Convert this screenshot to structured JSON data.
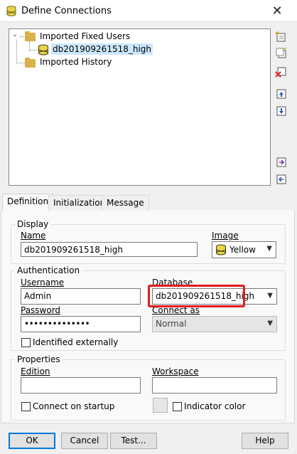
{
  "window": {
    "title": "Define Connections",
    "close_glyph": "✕"
  },
  "tree": {
    "groups": [
      {
        "label": "Imported Fixed Users",
        "expanded": true,
        "children": [
          {
            "label": "db201909261518_high",
            "selected": true
          }
        ]
      },
      {
        "label": "Imported History",
        "expanded": false,
        "children": []
      }
    ]
  },
  "side_toolbar": [
    "new-connection-icon",
    "copy-connection-icon",
    "delete-connection-icon",
    "move-up-icon",
    "move-down-icon",
    "import-icon",
    "export-icon"
  ],
  "tabs": [
    "Definition",
    "Initialization",
    "Message"
  ],
  "display": {
    "group_label": "Display",
    "name_label": "Name",
    "name_value": "db201909261518_high",
    "image_label": "Image",
    "image_value": "Yellow"
  },
  "authentication": {
    "group_label": "Authentication",
    "username_label": "Username",
    "username_value": "Admin",
    "database_label": "Database",
    "database_value": "db201909261518_high",
    "password_label": "Password",
    "password_value": "••••••••••••••",
    "connect_as_label": "Connect as",
    "connect_as_value": "Normal",
    "identified_label": "Identified externally"
  },
  "properties": {
    "group_label": "Properties",
    "edition_label": "Edition",
    "edition_value": "",
    "workspace_label": "Workspace",
    "workspace_value": "",
    "startup_label": "Connect on startup",
    "indicator_label": "Indicator color"
  },
  "buttons": {
    "ok": "OK",
    "cancel": "Cancel",
    "test": "Test...",
    "help": "Help"
  },
  "colors": {
    "highlight": "#e31b1b",
    "accent": "#0078d7",
    "selection": "#cce8ff"
  }
}
